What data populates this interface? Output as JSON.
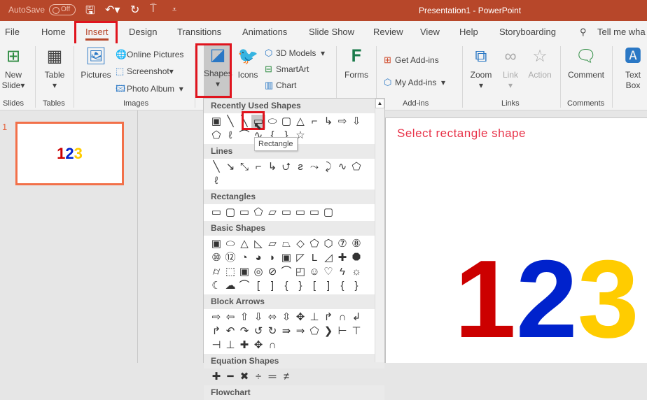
{
  "titlebar": {
    "autosave": "AutoSave",
    "toggle": "Off",
    "title": "Presentation1  -  PowerPoint"
  },
  "tabs": [
    "File",
    "Home",
    "Insert",
    "Design",
    "Transitions",
    "Animations",
    "Slide Show",
    "Review",
    "View",
    "Help",
    "Storyboarding",
    "Tell me wha"
  ],
  "ribbon": {
    "new_slide": "New",
    "new_slide2": "Slide",
    "table": "Table",
    "pictures": "Pictures",
    "online_pictures": "Online Pictures",
    "screenshot": "Screenshot",
    "photo_album": "Photo Album",
    "shapes": "Shapes",
    "icons": "Icons",
    "models": "3D Models",
    "smartart": "SmartArt",
    "chart": "Chart",
    "forms": "Forms",
    "get_addins": "Get Add-ins",
    "my_addins": "My Add-ins",
    "zoom": "Zoom",
    "link": "Link",
    "action": "Action",
    "comment": "Comment",
    "textbox": "Text",
    "textbox2": "Box",
    "groups": [
      "Slides",
      "Tables",
      "Images",
      "Add-ins",
      "Links",
      "Comments"
    ]
  },
  "dropdown": {
    "sections": [
      {
        "title": "Recently Used Shapes",
        "shapes": [
          "▣",
          "╲",
          "╲",
          "▭",
          "⬭",
          "▢",
          "△",
          "⌐",
          "↳",
          "⇨",
          "⇩",
          "⬠",
          "ℓ",
          "⌒",
          "∿",
          "{",
          "}",
          "☆"
        ]
      },
      {
        "title": "Lines",
        "shapes": [
          "╲",
          "↘",
          "⤡",
          "⌐",
          "↳",
          "⮍",
          "ƨ",
          "⤳",
          "⤸",
          "∿",
          "⬠",
          "ℓ"
        ]
      },
      {
        "title": "Rectangles",
        "shapes": [
          "▭",
          "▢",
          "▭",
          "⬠",
          "▱",
          "▭",
          "▭",
          "▭",
          "▢"
        ]
      },
      {
        "title": "Basic Shapes",
        "shapes": [
          "▣",
          "⬭",
          "△",
          "◺",
          "▱",
          "⏢",
          "◇",
          "⬠",
          "⬡",
          "⑦",
          "⑧",
          "⑩",
          "⑫",
          "◔",
          "◕",
          "◗",
          "▣",
          "◸",
          "L",
          "◿",
          "✚",
          "⯃",
          "⌭",
          "⬚",
          "▣",
          "◎",
          "⊘",
          "⌒",
          "◰",
          "☺",
          "♡",
          "ϟ",
          "☼",
          "☾",
          "☁",
          "⌒",
          "[",
          "]",
          "{",
          "}",
          "[",
          "]",
          "{",
          "}"
        ]
      },
      {
        "title": "Block Arrows",
        "shapes": [
          "⇨",
          "⇦",
          "⇧",
          "⇩",
          "⬄",
          "⇳",
          "✥",
          "⊥",
          "↱",
          "∩",
          "↲",
          "↱",
          "↶",
          "↷",
          "↺",
          "↻",
          "⇛",
          "⇒",
          "⬠",
          "❯",
          "⊢",
          "⊤",
          "⊣",
          "⊥",
          "✚",
          "✥",
          "∩"
        ]
      },
      {
        "title": "Equation Shapes",
        "shapes": [
          "✚",
          "━",
          "✖",
          "÷",
          "═",
          "≠"
        ]
      },
      {
        "title": "Flowchart",
        "shapes": []
      }
    ],
    "tooltip": "Rectangle"
  },
  "thumbnail": {
    "number": "1",
    "d1": "1",
    "d2": "2",
    "d3": "3"
  },
  "slide": {
    "hint": "Select rectangle shape",
    "d1": "1",
    "d2": "2",
    "d3": "3"
  },
  "colors": {
    "brand": "#b7472a",
    "highlight": "#e0141e",
    "one": "#cc0000",
    "two": "#0022cc",
    "three": "#ffcc00"
  }
}
